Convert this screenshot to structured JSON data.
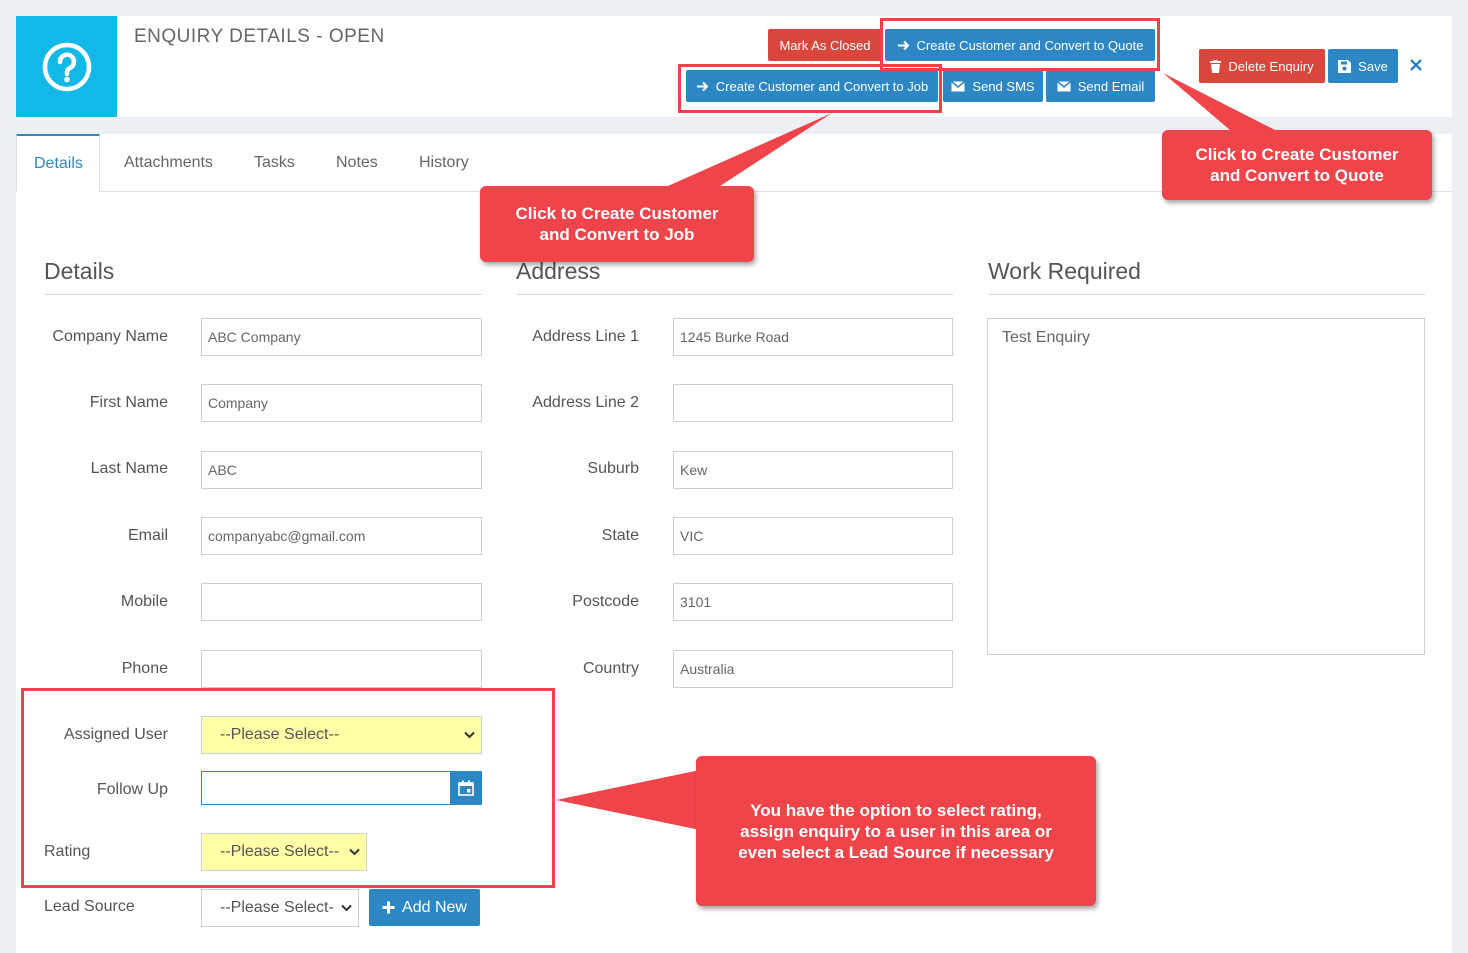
{
  "header": {
    "title": "ENQUIRY DETAILS - OPEN",
    "buttons": {
      "mark_closed": "Mark As Closed",
      "convert_quote": "Create Customer and Convert to Quote",
      "convert_job": "Create Customer and Convert to Job",
      "send_sms": "Send SMS",
      "send_email": "Send Email",
      "delete": "Delete Enquiry",
      "save": "Save"
    }
  },
  "tabs": [
    {
      "label": "Details",
      "active": true
    },
    {
      "label": "Attachments"
    },
    {
      "label": "Tasks"
    },
    {
      "label": "Notes"
    },
    {
      "label": "History"
    }
  ],
  "details": {
    "title": "Details",
    "company_name": {
      "label": "Company Name",
      "value": "ABC Company"
    },
    "first_name": {
      "label": "First Name",
      "value": "Company"
    },
    "last_name": {
      "label": "Last Name",
      "value": "ABC"
    },
    "email": {
      "label": "Email",
      "value": "companyabc@gmail.com"
    },
    "mobile": {
      "label": "Mobile",
      "value": ""
    },
    "phone": {
      "label": "Phone",
      "value": ""
    },
    "assigned_user": {
      "label": "Assigned User",
      "value": "--Please Select--"
    },
    "follow_up": {
      "label": "Follow Up",
      "value": ""
    },
    "rating": {
      "label": "Rating",
      "value": "--Please Select--"
    },
    "lead_source": {
      "label": "Lead Source",
      "value": "--Please Select-",
      "add_new": "Add New"
    }
  },
  "address": {
    "title": "Address",
    "line1": {
      "label": "Address Line 1",
      "value": "1245 Burke Road"
    },
    "line2": {
      "label": "Address Line 2",
      "value": ""
    },
    "suburb": {
      "label": "Suburb",
      "value": "Kew"
    },
    "state": {
      "label": "State",
      "value": "VIC"
    },
    "postcode": {
      "label": "Postcode",
      "value": "3101"
    },
    "country": {
      "label": "Country",
      "value": "Australia"
    }
  },
  "work": {
    "title": "Work Required",
    "value": "Test Enquiry"
  },
  "callouts": {
    "quote_line1": "Click to Create Customer",
    "quote_line2": "and Convert to Quote",
    "job_line1": "Click to Create Customer",
    "job_line2": "and Convert to Job",
    "rating_line1": "You have the option to select rating,",
    "rating_line2": "assign enquiry to a user in this area or",
    "rating_line3": "even select a Lead Source if necessary"
  },
  "colors": {
    "accent_blue": "#2e87c5",
    "header_cyan": "#13b9e6",
    "danger_red": "#d9463b",
    "callout_red": "#f0444b",
    "highlight_yellow": "#ffffa8"
  }
}
